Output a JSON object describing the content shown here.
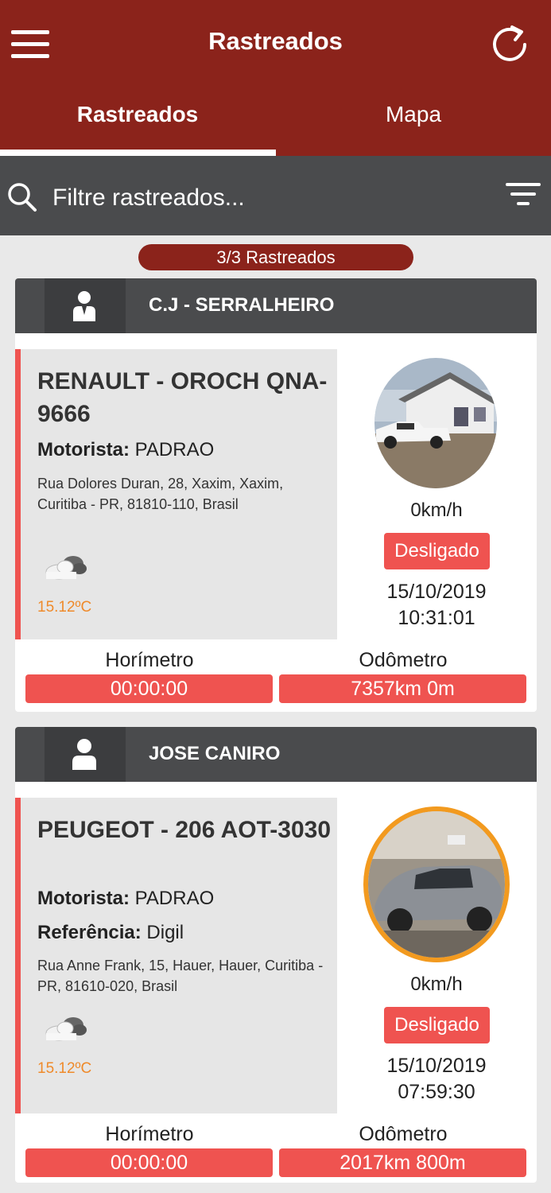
{
  "header": {
    "title": "Rastreados",
    "tabs": [
      {
        "label": "Rastreados",
        "active": true
      },
      {
        "label": "Mapa",
        "active": false
      }
    ],
    "menu_icon": "hamburger-menu-icon",
    "refresh_icon": "refresh-icon"
  },
  "search": {
    "placeholder": "Filtre rastreados...",
    "value": "",
    "search_icon": "search-icon",
    "filter_icon": "filter-icon"
  },
  "summary": {
    "count_label": "3/3 Rastreados"
  },
  "colors": {
    "brand": "#8b231b",
    "header_dark": "#4a4b4d",
    "accent_red": "#ef5350",
    "temperature": "#ef8a2a",
    "selected_ring": "#f29a1f"
  },
  "vehicles": [
    {
      "owner": "C.J - SERRALHEIRO",
      "owner_icon": "business-person-icon",
      "title": "RENAULT - OROCH QNA-9666",
      "driver_label": "Motorista:",
      "driver": "PADRAO",
      "address": "Rua Dolores Duran, 28, Xaxim, Xaxim, Curitiba - PR, 81810-110, Brasil",
      "weather_icon": "cloudy-icon",
      "temperature": "15.12ºC",
      "speed": "0km/h",
      "status": "Desligado",
      "date": "15/10/2019",
      "time": "10:31:01",
      "hourmeter_label": "Horímetro",
      "hourmeter": "00:00:00",
      "odometer_label": "Odômetro",
      "odometer": "7357km 0m"
    },
    {
      "owner": "JOSE CANIRO",
      "owner_icon": "person-icon",
      "title": "PEUGEOT - 206 AOT-3030",
      "driver_label": "Motorista:",
      "driver": "PADRAO",
      "reference_label": "Referência:",
      "reference": "Digil",
      "address": "Rua Anne Frank, 15, Hauer, Hauer, Curitiba - PR, 81610-020, Brasil",
      "weather_icon": "cloudy-icon",
      "temperature": "15.12ºC",
      "speed": "0km/h",
      "status": "Desligado",
      "date": "15/10/2019",
      "time": "07:59:30",
      "hourmeter_label": "Horímetro",
      "hourmeter": "00:00:00",
      "odometer_label": "Odômetro",
      "odometer": "2017km 800m"
    }
  ]
}
